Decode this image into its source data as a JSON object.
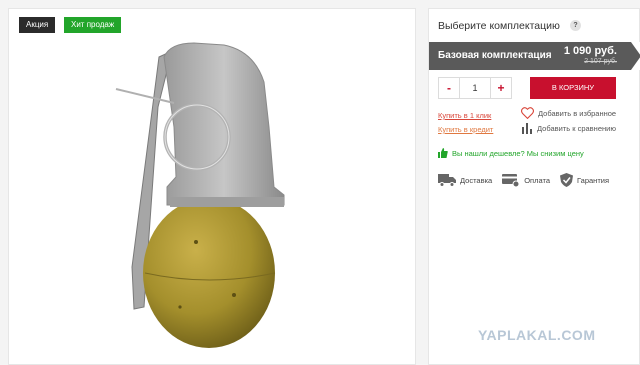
{
  "badges": {
    "sale": "Акция",
    "hit": "Хит продаж"
  },
  "panel": {
    "title": "Выберите комплектацию",
    "help": "?",
    "config": {
      "name": "Базовая комплектация",
      "price": "1 090 руб.",
      "old_price": "2 107 руб."
    },
    "quantity": {
      "minus": "-",
      "value": "1",
      "plus": "+"
    },
    "cart_button": "В корзину",
    "links": {
      "one_click": "Купить в 1 клик",
      "credit": "Купить в кредит"
    },
    "actions": {
      "favorites": "Добавить в избранное",
      "compare": "Добавить к сравнению"
    },
    "cheaper": "Вы нашли дешевле? Мы снизим цену",
    "features": {
      "delivery": "Доставка",
      "payment": "Оплата",
      "warranty": "Гарантия"
    }
  },
  "watermark": "YAPLAKAL.COM",
  "colors": {
    "accent": "#c8102e",
    "hit": "#22a52a",
    "sale": "#2b2b2b",
    "config_bg": "#5a5a5a"
  }
}
